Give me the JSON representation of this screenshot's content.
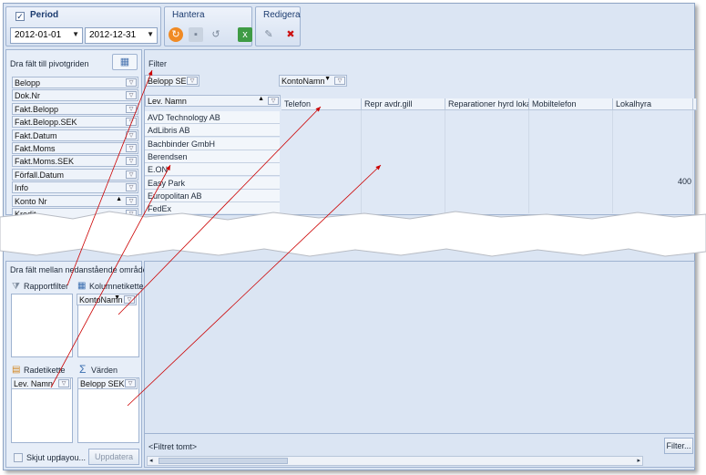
{
  "ribbon": {
    "period": {
      "title": "Period",
      "checked": "✓",
      "start_date": "2012-01-01",
      "end_date": "2012-12-31"
    },
    "hantera": {
      "title": "Hantera"
    },
    "redigera": {
      "title": "Redigera"
    }
  },
  "field_list": {
    "title": "Dra fält till pivotgriden",
    "fields": [
      "Belopp",
      "Dok.Nr",
      "Fakt.Belopp",
      "Fakt.Belopp.SEK",
      "Fakt.Datum",
      "Fakt.Moms",
      "Fakt.Moms.SEK",
      "Förfall.Datum",
      "Info",
      "Konto Nr",
      "Kredit"
    ]
  },
  "areas": {
    "title": "Dra fält mellan nedanstående områden:",
    "report_filter": "Rapportfilter",
    "column_labels": "Kolumnetikette",
    "row_labels": "Radetikette",
    "values": "Värden",
    "column_field": "KontoNamn",
    "row_field": "Lev. Namn",
    "value_field": "Belopp SEK",
    "defer_layout": "Skjut upp",
    "defer_layout_2": "layou...",
    "update_button": "Uppdatera"
  },
  "pivot": {
    "filter_label": "Filter",
    "data_field": "Belopp SEK",
    "column_field": "KontoNamn",
    "row_field": "Lev. Namn",
    "columns": [
      "Telefon",
      "Repr avdr.gill",
      "Reparationer hyrd lokal",
      "Mobiltelefon",
      "Lokalhyra"
    ],
    "rows": [
      "AVD Technology AB",
      "AdLibris AB",
      "Bachbinder GmbH",
      "Berendsen",
      "E.ON",
      "Easy Park",
      "Europolitan AB",
      "FedEx"
    ],
    "value_cell": "400",
    "filter_status": "<Filtret tomt>",
    "filter_button": "Filter..."
  },
  "colors": {
    "accent": "#1b3b6f",
    "arrow": "#cc0000",
    "panel": "#dbe5f3"
  }
}
